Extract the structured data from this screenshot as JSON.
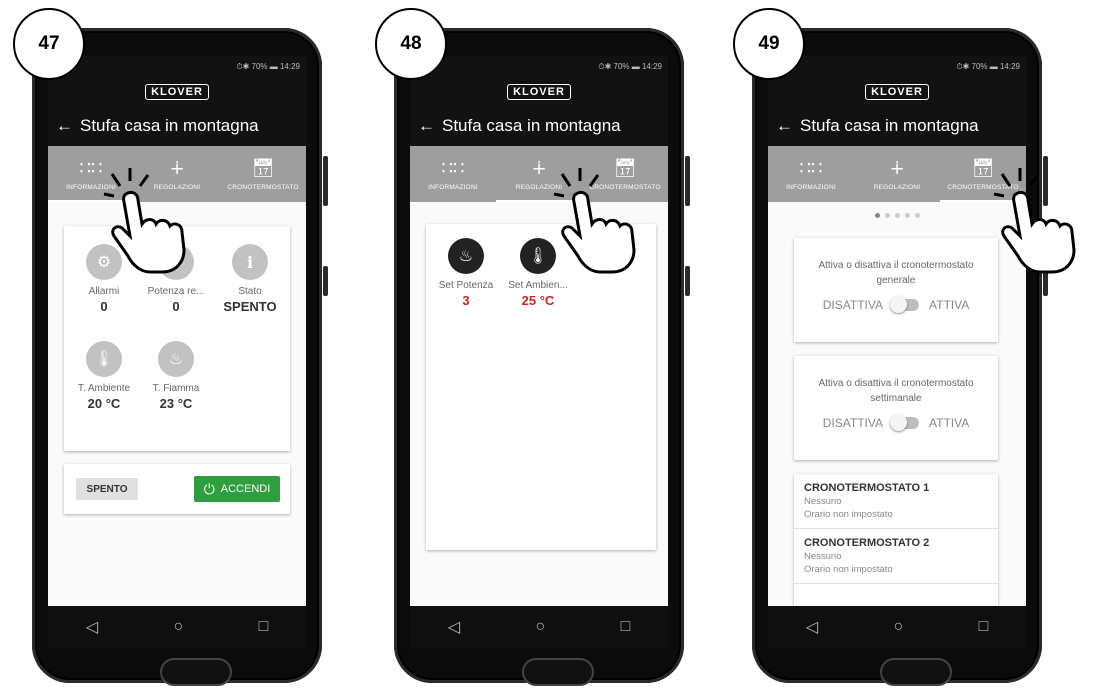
{
  "status": {
    "battery": "⏱✱ 70% ▬ 14:29",
    "wifi_icon": "wifi-icon"
  },
  "brand": "KLOVER",
  "title": "Stufa casa in montagna",
  "tabs": [
    "INFORMAZIONI",
    "REGOLAZIONI",
    "CRONOTERMOSTATO"
  ],
  "tabs_cut": [
    "INFORMAZIONI",
    "REGOLAZIONI",
    "CRONOTERMOSTATO"
  ],
  "phones": [
    {
      "step": "47",
      "active_tab": 0,
      "info_tiles": [
        {
          "name": "Allarmi",
          "value": "0"
        },
        {
          "name": "Potenza re...",
          "value": "0"
        },
        {
          "name": "Stato",
          "value": "SPENTO"
        },
        {
          "name": "T. Ambiente",
          "value": "20 °C"
        },
        {
          "name": "T. Fiamma",
          "value": "23 °C"
        }
      ],
      "state_button": "SPENTO",
      "power_button": "ACCENDI"
    },
    {
      "step": "48",
      "active_tab": 1,
      "reg_tiles": [
        {
          "name": "Set Potenza",
          "value": "3"
        },
        {
          "name": "Set Ambien...",
          "value": "25 °C"
        }
      ]
    },
    {
      "step": "49",
      "active_tab": 2,
      "toggles": [
        {
          "desc": "Attiva o disattiva il cronotermostato generale",
          "off": "DISATTIVA",
          "on": "ATTIVA"
        },
        {
          "desc": "Attiva o disattiva il cronotermostato settimanale",
          "off": "DISATTIVA",
          "on": "ATTIVA"
        }
      ],
      "cron": [
        {
          "title": "CRONOTERMOSTATO 1",
          "line1": "Nessuno",
          "line2": "Orario non impostato"
        },
        {
          "title": "CRONOTERMOSTATO 2",
          "line1": "Nessuno",
          "line2": "Orario non impostato"
        }
      ]
    }
  ],
  "nav": {
    "back": "◁",
    "home": "○",
    "recent": "□"
  }
}
